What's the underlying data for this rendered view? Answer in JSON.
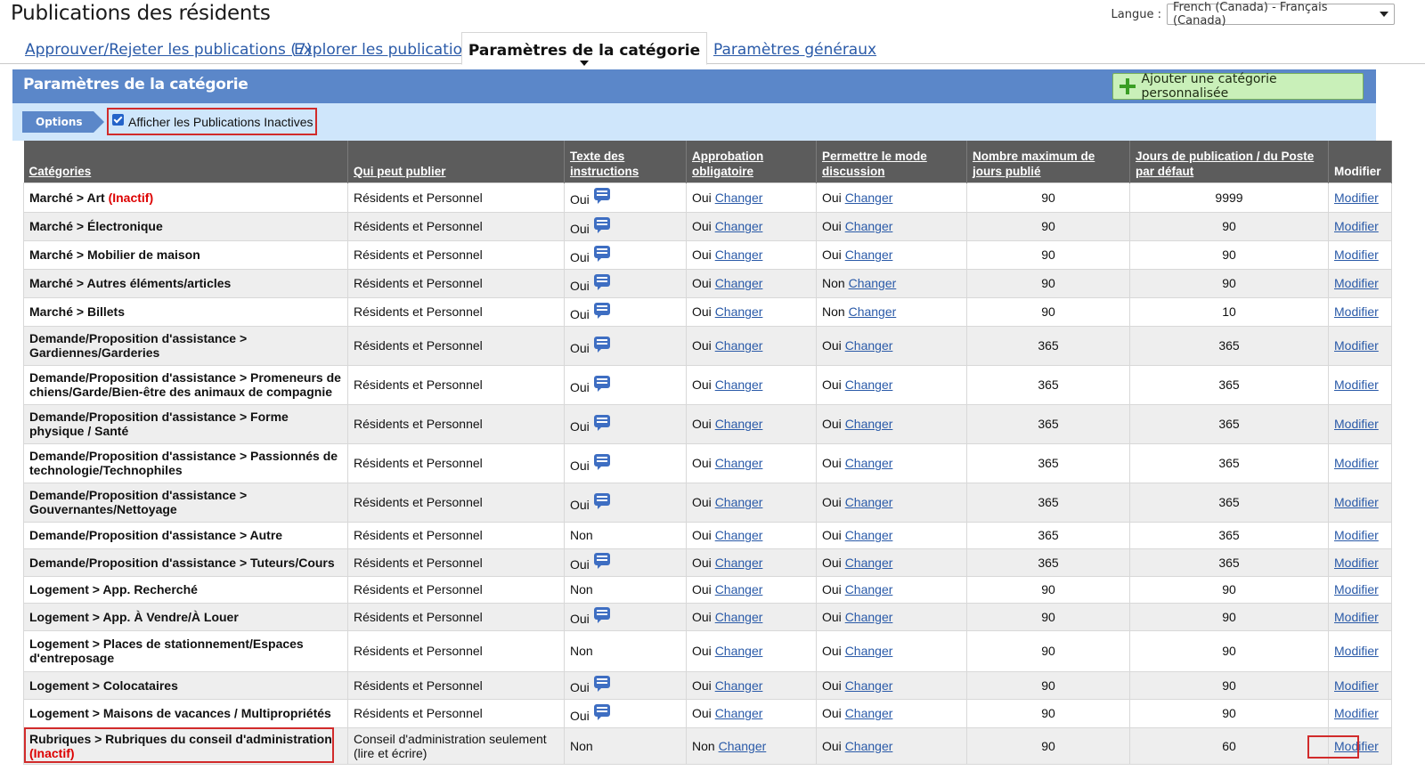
{
  "page": {
    "title": "Publications des résidents"
  },
  "language": {
    "label": "Langue :",
    "selected": "French (Canada) - Français (Canada)"
  },
  "tabs": [
    {
      "label": "Approuver/Rejeter les publications (7)"
    },
    {
      "label": "Explorer les publications"
    },
    {
      "label": "Paramètres de la catégorie"
    },
    {
      "label": "Paramètres généraux"
    }
  ],
  "section": {
    "title": "Paramètres de la catégorie",
    "add_button": "Ajouter une catégorie personnalisée",
    "options_tag": "Options",
    "show_inactive_label": "Afficher les Publications Inactives"
  },
  "table": {
    "headers": {
      "categories": "Catégories",
      "who": "Qui peut publier",
      "instructions": "Texte des instructions",
      "approval": "Approbation obligatoire",
      "discussion": "Permettre le mode discussion",
      "maxdays": "Nombre maximum de jours publié",
      "defaultdays": "Jours de publication / du Poste par défaut",
      "modify": "Modifier"
    },
    "change_label": "Changer",
    "modify_label": "Modifier",
    "rows": [
      {
        "category": "Marché > Art",
        "inactive": "(Inactif)",
        "who": "Résidents et Personnel",
        "instructions": "Oui",
        "bubble": true,
        "approval": "Oui",
        "discussion": "Oui",
        "maxdays": "90",
        "defaultdays": "9999"
      },
      {
        "category": "Marché > Électronique",
        "inactive": "",
        "who": "Résidents et Personnel",
        "instructions": "Oui",
        "bubble": true,
        "approval": "Oui",
        "discussion": "Oui",
        "maxdays": "90",
        "defaultdays": "90"
      },
      {
        "category": "Marché > Mobilier de maison",
        "inactive": "",
        "who": "Résidents et Personnel",
        "instructions": "Oui",
        "bubble": true,
        "approval": "Oui",
        "discussion": "Oui",
        "maxdays": "90",
        "defaultdays": "90"
      },
      {
        "category": "Marché > Autres éléments/articles",
        "inactive": "",
        "who": "Résidents et Personnel",
        "instructions": "Oui",
        "bubble": true,
        "approval": "Oui",
        "discussion": "Non",
        "maxdays": "90",
        "defaultdays": "90"
      },
      {
        "category": "Marché > Billets",
        "inactive": "",
        "who": "Résidents et Personnel",
        "instructions": "Oui",
        "bubble": true,
        "approval": "Oui",
        "discussion": "Non",
        "maxdays": "90",
        "defaultdays": "10"
      },
      {
        "category": "Demande/Proposition d'assistance > Gardiennes/Garderies",
        "inactive": "",
        "who": "Résidents et Personnel",
        "instructions": "Oui",
        "bubble": true,
        "approval": "Oui",
        "discussion": "Oui",
        "maxdays": "365",
        "defaultdays": "365"
      },
      {
        "category": "Demande/Proposition d'assistance > Promeneurs de chiens/Garde/Bien-être des animaux de compagnie",
        "inactive": "",
        "who": "Résidents et Personnel",
        "instructions": "Oui",
        "bubble": true,
        "approval": "Oui",
        "discussion": "Oui",
        "maxdays": "365",
        "defaultdays": "365"
      },
      {
        "category": "Demande/Proposition d'assistance > Forme physique / Santé",
        "inactive": "",
        "who": "Résidents et Personnel",
        "instructions": "Oui",
        "bubble": true,
        "approval": "Oui",
        "discussion": "Oui",
        "maxdays": "365",
        "defaultdays": "365"
      },
      {
        "category": "Demande/Proposition d'assistance > Passionnés de technologie/Technophiles",
        "inactive": "",
        "who": "Résidents et Personnel",
        "instructions": "Oui",
        "bubble": true,
        "approval": "Oui",
        "discussion": "Oui",
        "maxdays": "365",
        "defaultdays": "365"
      },
      {
        "category": "Demande/Proposition d'assistance > Gouvernantes/Nettoyage",
        "inactive": "",
        "who": "Résidents et Personnel",
        "instructions": "Oui",
        "bubble": true,
        "approval": "Oui",
        "discussion": "Oui",
        "maxdays": "365",
        "defaultdays": "365"
      },
      {
        "category": "Demande/Proposition d'assistance > Autre",
        "inactive": "",
        "who": "Résidents et Personnel",
        "instructions": "Non",
        "bubble": false,
        "approval": "Oui",
        "discussion": "Oui",
        "maxdays": "365",
        "defaultdays": "365"
      },
      {
        "category": "Demande/Proposition d'assistance > Tuteurs/Cours",
        "inactive": "",
        "who": "Résidents et Personnel",
        "instructions": "Oui",
        "bubble": true,
        "approval": "Oui",
        "discussion": "Oui",
        "maxdays": "365",
        "defaultdays": "365"
      },
      {
        "category": "Logement > App. Recherché",
        "inactive": "",
        "who": "Résidents et Personnel",
        "instructions": "Non",
        "bubble": false,
        "approval": "Oui",
        "discussion": "Oui",
        "maxdays": "90",
        "defaultdays": "90"
      },
      {
        "category": "Logement > App. À Vendre/À Louer",
        "inactive": "",
        "who": "Résidents et Personnel",
        "instructions": "Oui",
        "bubble": true,
        "approval": "Oui",
        "discussion": "Oui",
        "maxdays": "90",
        "defaultdays": "90"
      },
      {
        "category": "Logement > Places de stationnement/Espaces d'entreposage",
        "inactive": "",
        "who": "Résidents et Personnel",
        "instructions": "Non",
        "bubble": false,
        "approval": "Oui",
        "discussion": "Oui",
        "maxdays": "90",
        "defaultdays": "90"
      },
      {
        "category": "Logement > Colocataires",
        "inactive": "",
        "who": "Résidents et Personnel",
        "instructions": "Oui",
        "bubble": true,
        "approval": "Oui",
        "discussion": "Oui",
        "maxdays": "90",
        "defaultdays": "90"
      },
      {
        "category": "Logement > Maisons de vacances / Multipropriétés",
        "inactive": "",
        "who": "Résidents et Personnel",
        "instructions": "Oui",
        "bubble": true,
        "approval": "Oui",
        "discussion": "Oui",
        "maxdays": "90",
        "defaultdays": "90"
      },
      {
        "category": "Rubriques > Rubriques du conseil d'administration",
        "inactive": "(Inactif)",
        "who": "Conseil d'administration seulement (lire et écrire)",
        "instructions": "Non",
        "bubble": false,
        "approval": "Non",
        "discussion": "Oui",
        "maxdays": "90",
        "defaultdays": "60"
      }
    ]
  }
}
